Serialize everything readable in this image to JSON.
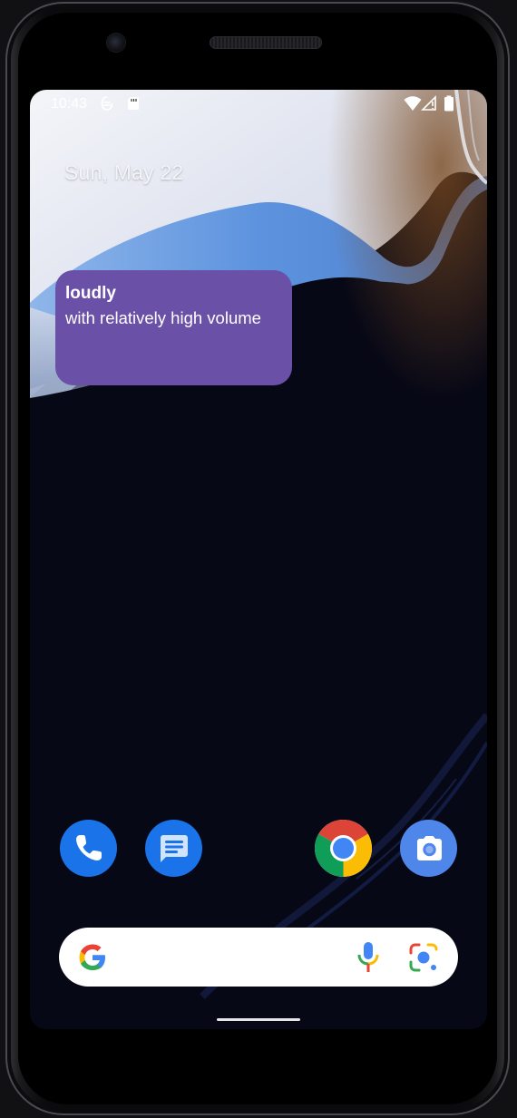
{
  "status_bar": {
    "time": "10:43",
    "left_icons": [
      "data-saver-icon",
      "sd-card-icon"
    ],
    "right_icons": [
      "wifi-icon",
      "signal-icon",
      "battery-icon"
    ]
  },
  "home": {
    "date": "Sun, May 22"
  },
  "widget": {
    "word": "loudly",
    "definition": "with relatively high volume",
    "background_color": "#6a50a7"
  },
  "dock": {
    "apps": [
      {
        "name": "Phone",
        "icon": "phone-icon",
        "color": "#1a73e8"
      },
      {
        "name": "Messages",
        "icon": "messages-icon",
        "color": "#1a73e8"
      },
      {
        "name": "Chrome",
        "icon": "chrome-icon"
      },
      {
        "name": "Camera",
        "icon": "camera-icon",
        "color": "#4f86ea"
      }
    ]
  },
  "search_bar": {
    "icons": [
      "google-g-icon",
      "mic-icon",
      "lens-icon"
    ]
  },
  "colors": {
    "accent_blue": "#1a73e8",
    "google_red": "#ea4335",
    "google_yellow": "#fbbc04",
    "google_green": "#34a853",
    "google_blue": "#4285f4"
  }
}
